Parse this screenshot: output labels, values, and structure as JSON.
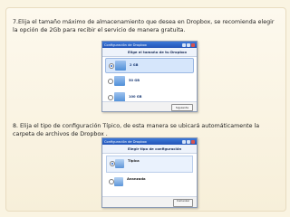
{
  "step7": {
    "text": "7.Elija el tamaño máximo de almacenamiento que desea en Dropbox, se recomienda elegir la opción de 2Gb para recibir el servicio de manera gratuita."
  },
  "dialog1": {
    "window_title": "Configuración de Dropbox",
    "header": "Elige el tamaño de tu Dropbox",
    "options": [
      {
        "label": "2 GB",
        "selected": true
      },
      {
        "label": "50 GB",
        "selected": false
      },
      {
        "label": "100 GB",
        "selected": false
      }
    ],
    "button": "Siguiente"
  },
  "step8": {
    "text": "8. Elija el tipo de configuración Típico, de esta manera se ubicará automáticamente la carpeta de archivos de Dropbox ."
  },
  "dialog2": {
    "window_title": "Configuración de Dropbox",
    "header": "Elegir tipo de configuración",
    "options": [
      {
        "title": "Típica",
        "selected": true
      },
      {
        "title": "Avanzada",
        "selected": false
      }
    ],
    "button": "Comenzar"
  }
}
